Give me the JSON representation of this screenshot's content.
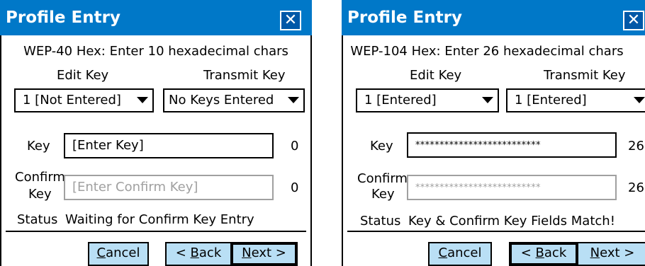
{
  "screens": [
    {
      "title": "Profile Entry",
      "close_glyph": "✕",
      "header": "WEP-40 Hex: Enter 10 hexadecimal chars",
      "edit_key_label": "Edit Key",
      "transmit_key_label": "Transmit Key",
      "edit_key_value": "1 [Not Entered]",
      "transmit_key_value": "No Keys Entered",
      "key_label": "Key",
      "key_value": "[Enter Key]",
      "key_count": "0",
      "confirm_label_1": "Confirm",
      "confirm_label_2": "Key",
      "confirm_value": "[Enter Confirm Key]",
      "confirm_count": "0",
      "status_label": "Status",
      "status_text": "Waiting for Confirm Key Entry",
      "cancel": {
        "hot": "C",
        "rest": "ancel"
      },
      "back": {
        "pre": "< ",
        "hot": "B",
        "rest": "ack"
      },
      "next": {
        "hot": "N",
        "rest": "ext >"
      }
    },
    {
      "title": "Profile Entry",
      "close_glyph": "✕",
      "header": "WEP-104 Hex: Enter 26 hexadecimal chars",
      "edit_key_label": "Edit Key",
      "transmit_key_label": "Transmit Key",
      "edit_key_value": "1 [Entered]",
      "transmit_key_value": "1 [Entered]",
      "key_label": "Key",
      "key_value": "**************************",
      "key_count": "26",
      "confirm_label_1": "Confirm",
      "confirm_label_2": "Key",
      "confirm_value": "**************************",
      "confirm_count": "26",
      "status_label": "Status",
      "status_text": "Key & Confirm Key Fields Match!",
      "cancel": {
        "hot": "C",
        "rest": "ancel"
      },
      "back": {
        "pre": "< ",
        "hot": "B",
        "rest": "ack"
      },
      "next": {
        "hot": "N",
        "rest": "ext >"
      }
    }
  ],
  "colors": {
    "titlebar": "#0078c8",
    "button_face": "#b9dff5",
    "placeholder": "#a0a0a0"
  }
}
